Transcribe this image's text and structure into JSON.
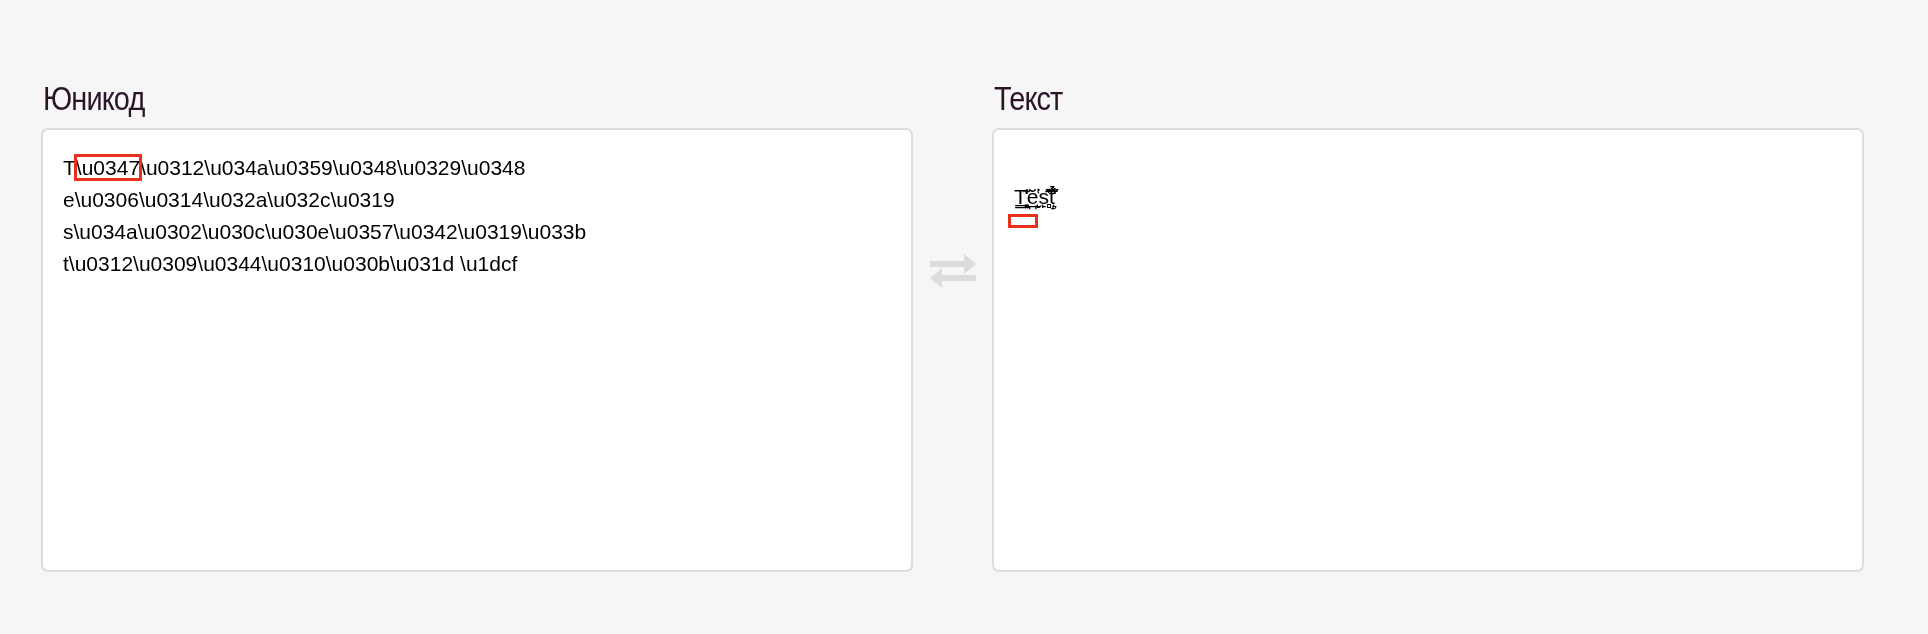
{
  "unicode_panel": {
    "heading": "Юникод",
    "lines": [
      [
        {
          "text": "T",
          "highlighted": false
        },
        {
          "text": "\\u0347",
          "highlighted": true
        },
        {
          "text": "\\u0312\\u034a\\u0359\\u0348\\u0329\\u0348",
          "highlighted": false
        }
      ],
      [
        {
          "text": "e\\u0306\\u0314\\u032a\\u032c\\u0319",
          "highlighted": false
        }
      ],
      [
        {
          "text": "s\\u034a\\u0302\\u030c\\u030e\\u0357\\u0342\\u0319\\u033b",
          "highlighted": false
        }
      ],
      [
        {
          "text": "t\\u0312\\u0309\\u0344\\u0310\\u030b\\u031d \\u1dcf",
          "highlighted": false
        }
      ]
    ]
  },
  "text_panel": {
    "heading": "Текст",
    "value": "T͇͙͈̩͈̒͊ĕ̪̬̙̔s̙̻͊̂̌̎͗͂t̝̒̉̈́̐̋ ᷏",
    "highlighted": true
  }
}
